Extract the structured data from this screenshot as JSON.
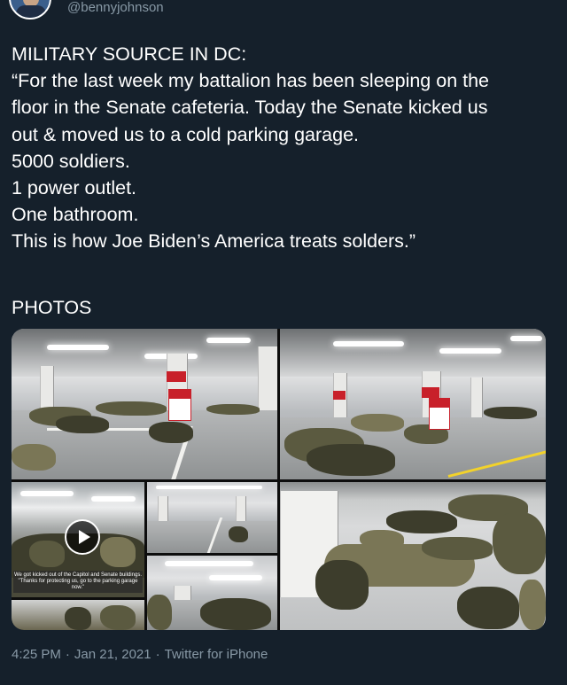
{
  "header": {
    "handle": "@bennyjohnson"
  },
  "tweet": {
    "lines": [
      "MILITARY SOURCE IN DC:",
      "“For the last week my battalion has been sleeping on the",
      "floor in the Senate cafeteria. Today the Senate kicked us",
      "out & moved us to a cold parking garage.",
      "5000 soldiers.",
      "1 power outlet.",
      "One bathroom.",
      "This is how Joe Biden’s America treats solders.”"
    ],
    "photos_label": "PHOTOS"
  },
  "media": {
    "video_caption": "We got kicked out of the Capitol and Senate buildings. \"Thanks for protecting us, go to the parking garage now.\"",
    "icons": [
      "play-icon"
    ]
  },
  "footer": {
    "time": "4:25 PM",
    "date": "Jan 21, 2021",
    "source": "Twitter for iPhone",
    "separator": "·"
  },
  "colors": {
    "background": "#15202b",
    "text": "#ffffff",
    "secondary": "#8899a6",
    "accent_red": "#c8202a",
    "caution_tape": "#f2d22b"
  }
}
